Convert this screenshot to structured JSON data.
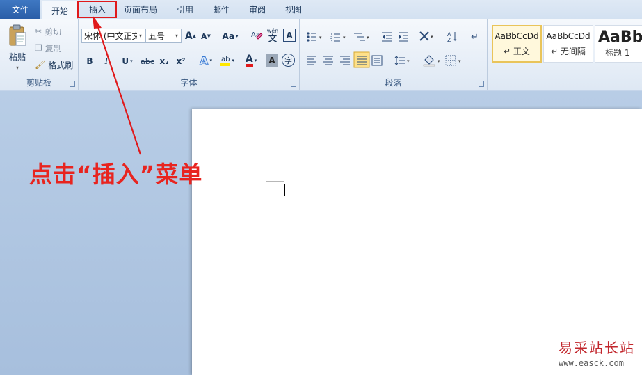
{
  "tabs": {
    "file": "文件",
    "items": [
      "开始",
      "插入",
      "页面布局",
      "引用",
      "邮件",
      "审阅",
      "视图"
    ]
  },
  "clipboard": {
    "paste": "粘贴",
    "cut": "剪切",
    "copy": "复制",
    "format_painter": "格式刷",
    "group_label": "剪贴板"
  },
  "font": {
    "font_name": "宋体 (中文正文",
    "font_size": "五号",
    "group_label": "字体",
    "bold": "B",
    "italic": "I",
    "underline": "U",
    "strike": "abc",
    "subscript": "x₂",
    "superscript": "x²",
    "case": "Aa",
    "grow": "A",
    "shrink": "A",
    "text_effect": "A",
    "highlight": "ab",
    "font_color": "A",
    "char_shade": "A",
    "enclose": "字",
    "pinyin": "wén",
    "char_border": "A"
  },
  "paragraph": {
    "group_label": "段落"
  },
  "styles": {
    "items": [
      {
        "sample": "AaBbCcDd",
        "name": "↵ 正文"
      },
      {
        "sample": "AaBbCcDd",
        "name": "↵ 无间隔"
      },
      {
        "sample": "AaBb",
        "name": "标题 1"
      }
    ]
  },
  "annotation": "点击“插入”菜单",
  "watermark": {
    "cn": "易采站长站",
    "url": "www.easck.com"
  },
  "colors": {
    "accent_red": "#e0191b",
    "file_tab": "#2a5ea8"
  }
}
